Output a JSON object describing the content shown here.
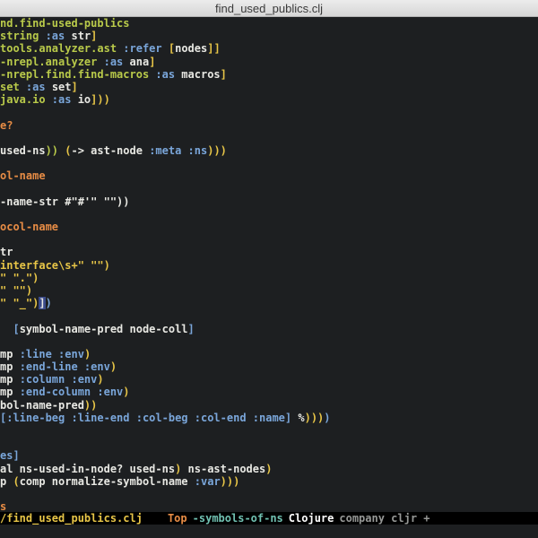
{
  "window": {
    "title": "find_used_publics.clj"
  },
  "code_lines": [
    [
      {
        "t": "nd.find-used-publics",
        "c": "tok-ns"
      }
    ],
    [
      {
        "t": "string ",
        "c": "tok-ns"
      },
      {
        "t": ":as",
        "c": "tok-key"
      },
      {
        "t": " str",
        "c": "tok-sym"
      },
      {
        "t": "]",
        "c": "tok-bracket"
      }
    ],
    [
      {
        "t": "tools.analyzer.ast ",
        "c": "tok-ns"
      },
      {
        "t": ":refer",
        "c": "tok-key"
      },
      {
        "t": " [",
        "c": "tok-bracket"
      },
      {
        "t": "nodes",
        "c": "tok-sym"
      },
      {
        "t": "]]",
        "c": "tok-bracket"
      }
    ],
    [
      {
        "t": "-nrepl.analyzer ",
        "c": "tok-ns"
      },
      {
        "t": ":as",
        "c": "tok-key"
      },
      {
        "t": " ana",
        "c": "tok-sym"
      },
      {
        "t": "]",
        "c": "tok-bracket"
      }
    ],
    [
      {
        "t": "-nrepl.find.find-macros ",
        "c": "tok-ns"
      },
      {
        "t": ":as",
        "c": "tok-key"
      },
      {
        "t": " macros",
        "c": "tok-sym"
      },
      {
        "t": "]",
        "c": "tok-bracket"
      }
    ],
    [
      {
        "t": "set ",
        "c": "tok-ns"
      },
      {
        "t": ":as",
        "c": "tok-key"
      },
      {
        "t": " set",
        "c": "tok-sym"
      },
      {
        "t": "]",
        "c": "tok-bracket"
      }
    ],
    [
      {
        "t": "java.io ",
        "c": "tok-ns"
      },
      {
        "t": ":as",
        "c": "tok-key"
      },
      {
        "t": " io",
        "c": "tok-sym"
      },
      {
        "t": "]))",
        "c": "tok-bracket"
      }
    ],
    [],
    [
      {
        "t": "e?",
        "c": "tok-def"
      }
    ],
    [],
    [
      {
        "t": "used-ns",
        "c": "tok-sym"
      },
      {
        "t": "))",
        "c": "tok-paren2"
      },
      {
        "t": " (",
        "c": "tok-paren1"
      },
      {
        "t": "-> ast-node ",
        "c": "tok-sym"
      },
      {
        "t": ":meta :ns",
        "c": "tok-key"
      },
      {
        "t": ")))",
        "c": "tok-paren1"
      }
    ],
    [],
    [
      {
        "t": "ol-name",
        "c": "tok-def"
      }
    ],
    [],
    [
      {
        "t": "-name-str #\"#'\" \"\"))",
        "c": "tok-sym"
      }
    ],
    [],
    [
      {
        "t": "ocol-name",
        "c": "tok-def"
      }
    ],
    [],
    [
      {
        "t": "tr",
        "c": "tok-sym"
      }
    ],
    [
      {
        "t": "interface\\s+\" \"\")",
        "c": "tok-paren1"
      }
    ],
    [
      {
        "t": "\" \".\")",
        "c": "tok-paren1"
      }
    ],
    [
      {
        "t": "\" \"\")",
        "c": "tok-paren1"
      }
    ],
    [
      {
        "t": "\" \"_\")",
        "c": "tok-paren1"
      },
      {
        "t": "]",
        "c": "tok-hl"
      },
      {
        "t": ")",
        "c": "tok-paren3"
      }
    ],
    [],
    [
      {
        "t": "  [",
        "c": "tok-paren3"
      },
      {
        "t": "symbol-name-pred node-coll",
        "c": "tok-sym"
      },
      {
        "t": "]",
        "c": "tok-paren3"
      }
    ],
    [],
    [
      {
        "t": "mp ",
        "c": "tok-sym"
      },
      {
        "t": ":line :env",
        "c": "tok-key"
      },
      {
        "t": ")",
        "c": "tok-paren1"
      }
    ],
    [
      {
        "t": "mp ",
        "c": "tok-sym"
      },
      {
        "t": ":end-line :env",
        "c": "tok-key"
      },
      {
        "t": ")",
        "c": "tok-paren1"
      }
    ],
    [
      {
        "t": "mp ",
        "c": "tok-sym"
      },
      {
        "t": ":column :env",
        "c": "tok-key"
      },
      {
        "t": ")",
        "c": "tok-paren1"
      }
    ],
    [
      {
        "t": "mp ",
        "c": "tok-sym"
      },
      {
        "t": ":end-column :env",
        "c": "tok-key"
      },
      {
        "t": ")",
        "c": "tok-paren1"
      }
    ],
    [
      {
        "t": "bol-name-pred",
        "c": "tok-sym"
      },
      {
        "t": "))",
        "c": "tok-paren1"
      }
    ],
    [
      {
        "t": "[",
        "c": "tok-paren3"
      },
      {
        "t": ":line-beg :line-end :col-beg :col-end :name",
        "c": "tok-key"
      },
      {
        "t": "] ",
        "c": "tok-paren3"
      },
      {
        "t": "%",
        "c": "tok-sym"
      },
      {
        "t": ")))",
        "c": "tok-paren1"
      },
      {
        "t": ")",
        "c": "tok-paren3"
      }
    ],
    [],
    [],
    [
      {
        "t": "es]",
        "c": "tok-paren3"
      }
    ],
    [
      {
        "t": "al ns-used-in-node? used-ns",
        "c": "tok-sym"
      },
      {
        "t": ")",
        "c": "tok-paren1"
      },
      {
        "t": " ns-ast-nodes",
        "c": "tok-sym"
      },
      {
        "t": ")",
        "c": "tok-paren1"
      }
    ],
    [
      {
        "t": "p ",
        "c": "tok-sym"
      },
      {
        "t": "(",
        "c": "tok-paren1"
      },
      {
        "t": "comp normalize-symbol-name ",
        "c": "tok-sym"
      },
      {
        "t": ":var",
        "c": "tok-key"
      },
      {
        "t": ")))",
        "c": "tok-paren1"
      }
    ],
    [],
    [
      {
        "t": "s",
        "c": "tok-def"
      }
    ]
  ],
  "modeline": {
    "file": "/find_used_publics.clj",
    "position": "Top",
    "function": "-symbols-of-ns",
    "major_mode": "Clojure",
    "minor_modes": "company cljr +"
  },
  "colors": {
    "background": "#1d1f21",
    "keyword": "#7aa6da",
    "namespace": "#b9ca4a",
    "paren": "#e7c547",
    "definition": "#e78c45",
    "modeline_bg": "#000000"
  }
}
